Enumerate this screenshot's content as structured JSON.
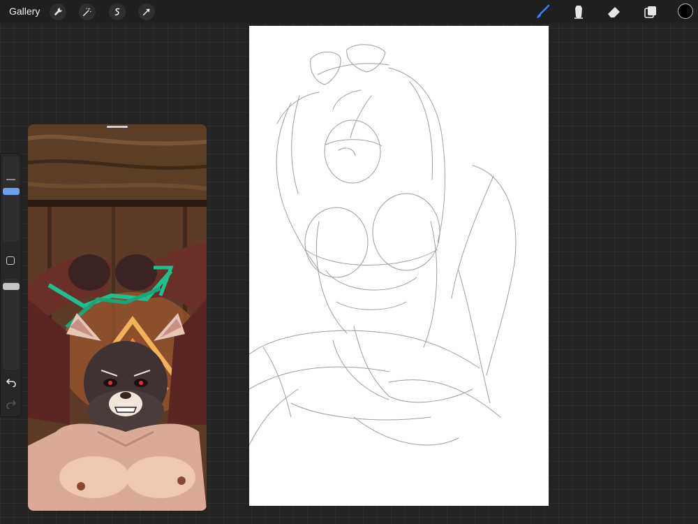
{
  "toolbar": {
    "gallery_label": "Gallery",
    "left_icons": [
      "wrench-icon",
      "magic-wand-icon",
      "selection-icon",
      "transform-arrow-icon"
    ],
    "right_icons": [
      "brush-icon",
      "smudge-icon",
      "eraser-icon",
      "layers-icon"
    ],
    "active_tool": "brush",
    "accent_color": "#3b82f6",
    "current_color": "#000000"
  },
  "sidebar": {
    "controls": [
      "brush-size-slider",
      "modify-button",
      "opacity-slider",
      "undo-button",
      "redo-button"
    ]
  },
  "reference": {
    "description_icon": "reference-image"
  }
}
